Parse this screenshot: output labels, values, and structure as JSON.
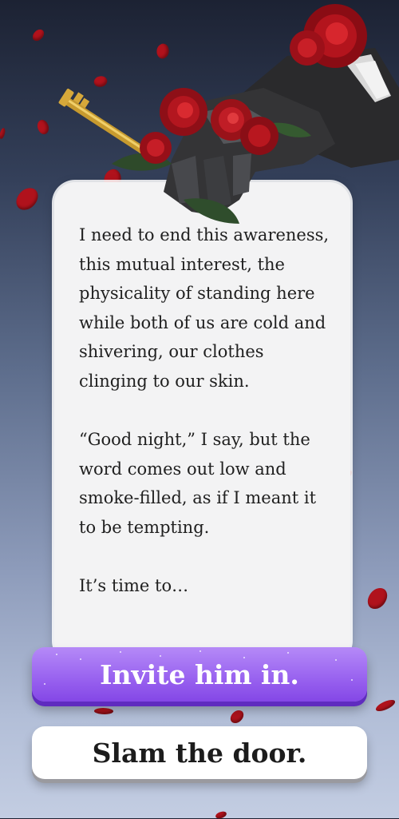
{
  "story": {
    "paragraphs": [
      "I need to end this awareness, this mutual interest, the physicality of standing here while both of us are cold and shivering, our clothes clinging to our skin.",
      "“Good night,” I say, but the word comes out low and smoke-filled, as if I meant it to be tempting.",
      "It’s time to…"
    ]
  },
  "choices": [
    {
      "label": "Invite him in."
    },
    {
      "label": "Slam the door."
    }
  ],
  "colors": {
    "primary_choice": "#9a64f0",
    "secondary_choice": "#ffffff",
    "rose": "#b0121c",
    "card": "#f3f3f4"
  },
  "illustration": {
    "subject": "gloved-hand-holding-red-roses-and-golden-key"
  }
}
